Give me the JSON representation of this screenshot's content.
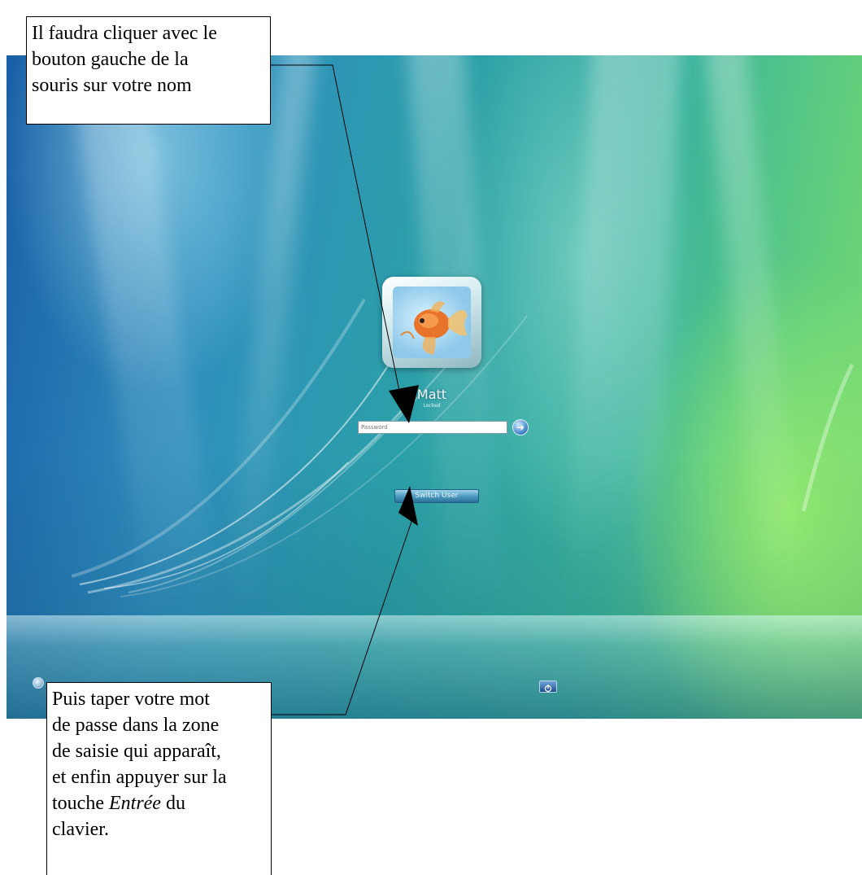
{
  "login_screen": {
    "user": {
      "name": "Matt",
      "status": "Locked"
    },
    "password_field": {
      "placeholder": "Password"
    },
    "go_button_glyph": "➜",
    "switch_user_label": "Switch User",
    "icons": {
      "ease_of_access": "ease-of-access-icon",
      "power": "power-icon",
      "avatar": "goldfish-avatar"
    }
  },
  "annotations": {
    "top_callout": [
      "Il faudra cliquer avec le",
      "bouton gauche de la",
      "souris sur votre nom"
    ],
    "bottom_callout": [
      "Puis taper votre  mot",
      "de passe dans la zone",
      "de saisie qui apparaît,",
      "et enfin appuyer sur la",
      {
        "before": "touche ",
        "emphasis": "Entrée",
        "after": " du"
      },
      "clavier."
    ]
  }
}
